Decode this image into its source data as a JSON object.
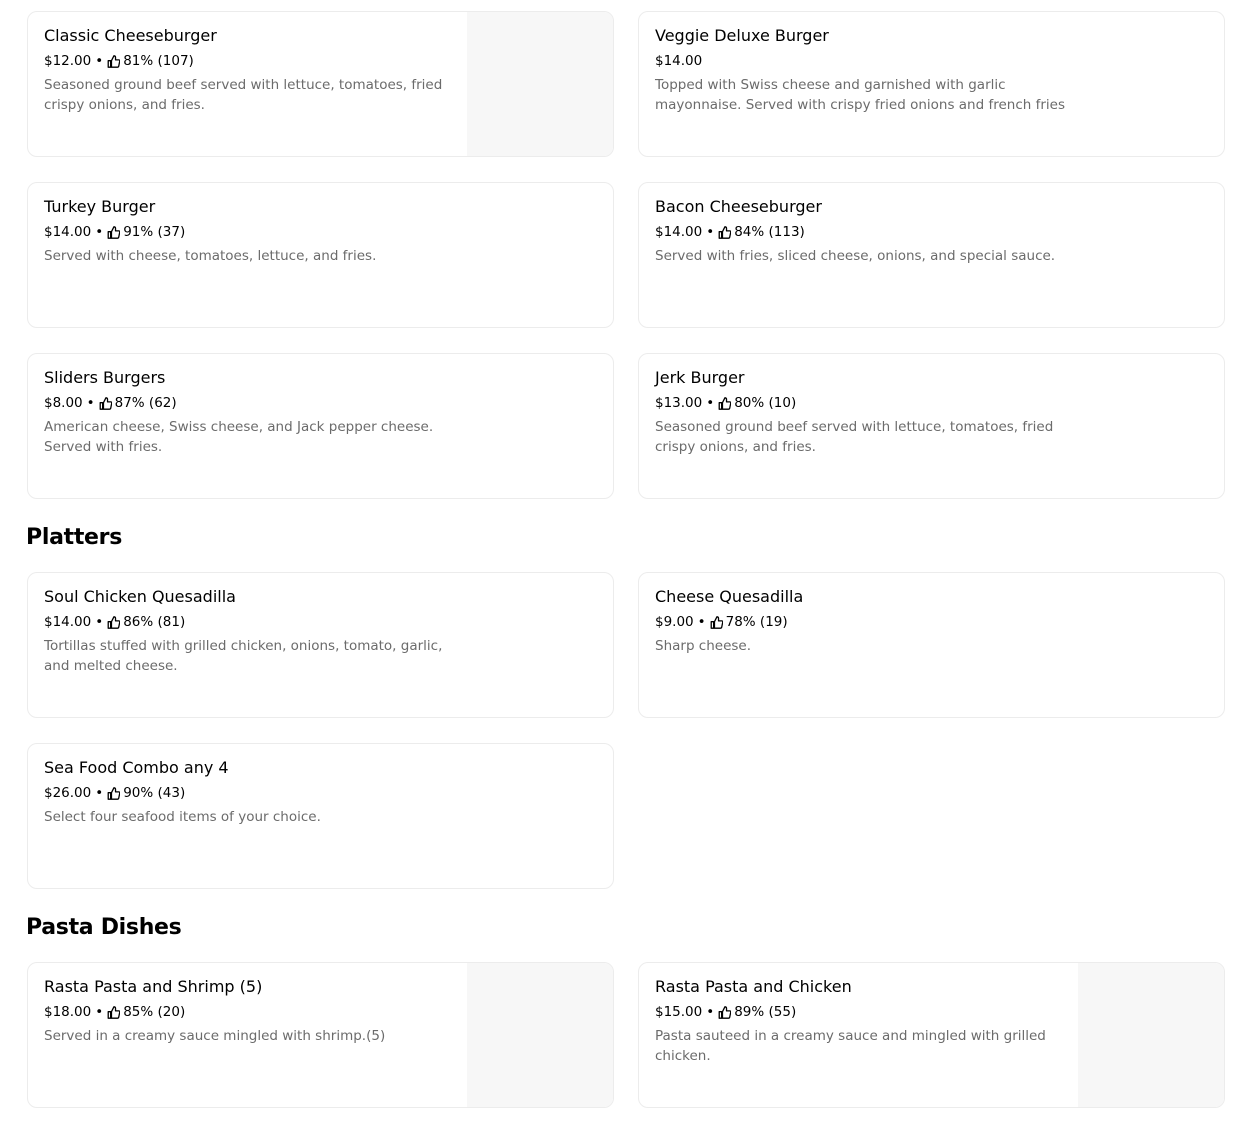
{
  "burgers": [
    {
      "name": "Classic Cheeseburger",
      "price": "$12.00",
      "rating": "81% (107)",
      "description": "Seasoned ground beef served with lettuce, tomatoes, fried crispy onions, and fries."
    },
    {
      "name": "Veggie Deluxe Burger",
      "price": "$14.00",
      "rating": "",
      "description": "Topped with Swiss cheese and garnished with garlic mayonnaise. Served with crispy fried onions and french fries"
    },
    {
      "name": "Turkey Burger",
      "price": "$14.00",
      "rating": "91% (37)",
      "description": "Served with cheese, tomatoes, lettuce, and fries."
    },
    {
      "name": "Bacon Cheeseburger",
      "price": "$14.00",
      "rating": "84% (113)",
      "description": "Served with fries, sliced cheese, onions, and special sauce."
    },
    {
      "name": "Sliders Burgers",
      "price": "$8.00",
      "rating": "87% (62)",
      "description": "American cheese, Swiss cheese, and Jack pepper cheese. Served with fries."
    },
    {
      "name": "Jerk Burger",
      "price": "$13.00",
      "rating": "80% (10)",
      "description": "Seasoned ground beef served with lettuce, tomatoes, fried crispy onions, and fries."
    }
  ],
  "platters": {
    "title": "Platters",
    "items": [
      {
        "name": "Soul Chicken Quesadilla",
        "price": "$14.00",
        "rating": "86% (81)",
        "description": "Tortillas stuffed with grilled chicken, onions, tomato, garlic, and melted cheese."
      },
      {
        "name": "Cheese Quesadilla",
        "price": "$9.00",
        "rating": "78% (19)",
        "description": "Sharp cheese."
      },
      {
        "name": "Sea Food Combo any 4",
        "price": "$26.00",
        "rating": "90% (43)",
        "description": "Select four seafood items of your choice."
      }
    ]
  },
  "pasta": {
    "title": "Pasta Dishes",
    "items": [
      {
        "name": "Rasta Pasta and Shrimp (5)",
        "price": "$18.00",
        "rating": "85% (20)",
        "description": "Served in a creamy sauce mingled with shrimp.(5)"
      },
      {
        "name": "Rasta Pasta and Chicken",
        "price": "$15.00",
        "rating": "89% (55)",
        "description": "Pasta sauteed in a creamy sauce and mingled with grilled chicken."
      }
    ]
  },
  "icons": {
    "rating": "thumbs-up-icon"
  },
  "colors": {
    "description": "#6b6b6b",
    "border": "#ececec",
    "thumb_bg": "#f7f7f7"
  }
}
